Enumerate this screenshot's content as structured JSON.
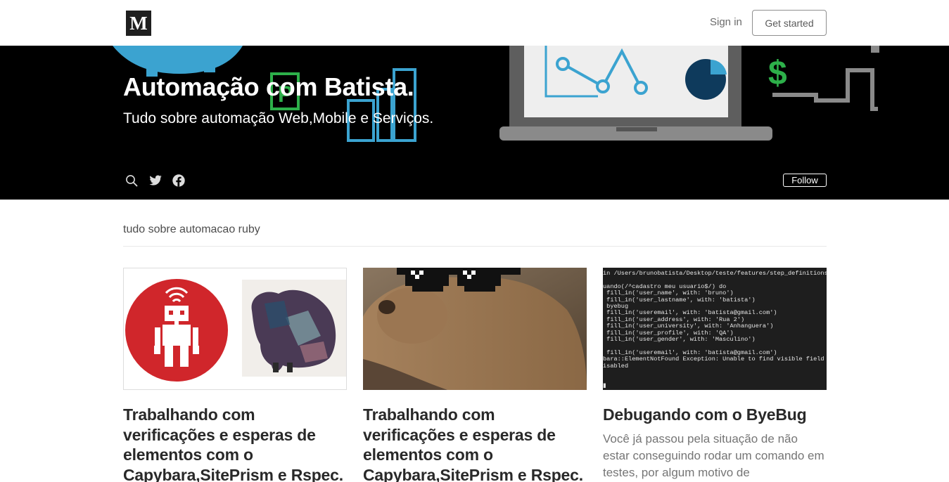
{
  "header": {
    "logo": "M",
    "sign_in": "Sign in",
    "get_started": "Get started"
  },
  "hero": {
    "title": "Automação com Batista.",
    "tagline": "Tudo sobre automação Web,Mobile e Serviços.",
    "follow": "Follow",
    "icons": [
      "search-icon",
      "twitter-icon",
      "facebook-icon"
    ]
  },
  "section": {
    "title": "tudo sobre automacao ruby"
  },
  "posts": [
    {
      "title": "Trabalhando com verificações e esperas de elementos com o Capybara,SitePrism e Rspec. (Parte III).",
      "excerpt": ""
    },
    {
      "title": "Trabalhando com verificações e esperas de elementos com o Capybara,SitePrism e Rspec. (Parte II).",
      "excerpt": ""
    },
    {
      "title": "Debugando com o ByeBug",
      "excerpt": "Você já passou pela situação de não estar conseguindo rodar um comando em testes, por algum motivo de"
    }
  ],
  "terminal_lines": [
    "in /Users/brunobatista/Desktop/teste/features/step_definitions/login.",
    "",
    "uando(/^cadastro meu usuario$/) do",
    " fill_in('user_name', with: 'bruno')",
    " fill_in('user_lastname', with: 'batista')",
    " byebug",
    " fill_in('useremail', with: 'batista@gmail.com')",
    " fill_in('user_address', with: 'Rua 2')",
    " fill_in('user_university', with: 'Anhanguera')",
    " fill_in('user_profile', with: 'QA')",
    " fill_in('user_gender', with: 'Masculino')",
    "",
    " fill_in('useremail', with: 'batista@gmail.com')",
    "bara::ElementNotFound Exception: Unable to find visible field \"userem",
    "isabled",
    "",
    "",
    "▮"
  ],
  "colors": {
    "hero_bg": "#000000",
    "accent_blue": "#3ba3d0",
    "robot_red": "#d0262b",
    "dollar_green": "#2db04a"
  }
}
